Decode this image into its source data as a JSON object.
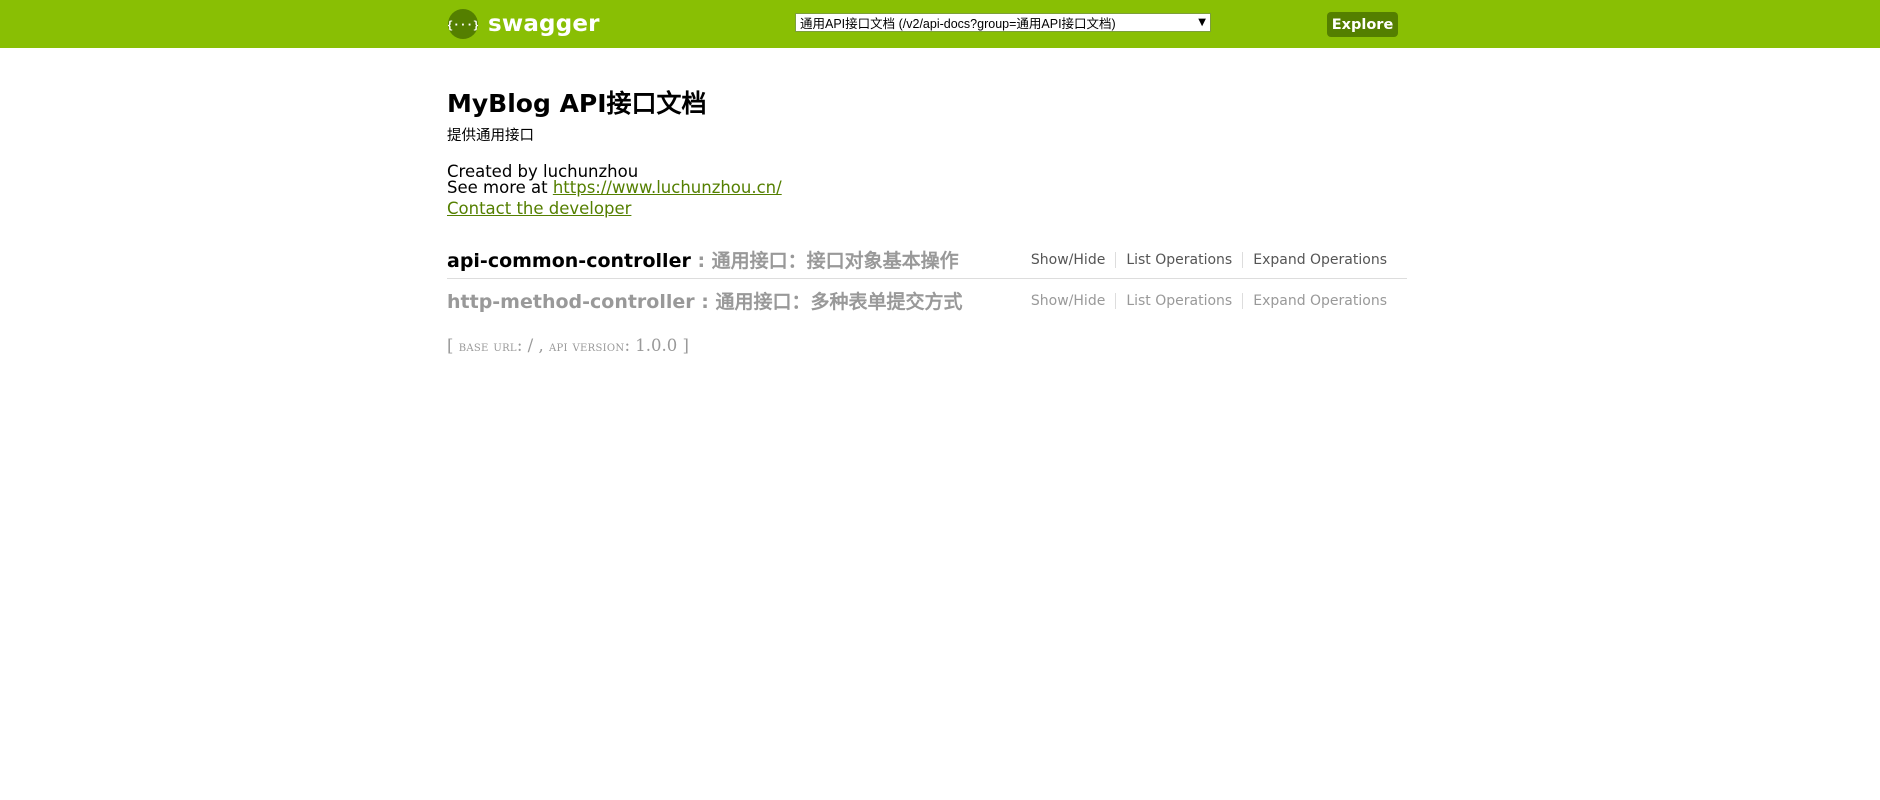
{
  "header": {
    "brand_name": "swagger",
    "spec_select_value": "通用API接口文档 (/v2/api-docs?group=通用API接口文档)",
    "explore_label": "Explore",
    "colors": {
      "bar": "#89bf04",
      "accent": "#547f00"
    }
  },
  "info": {
    "title": "MyBlog API接口文档",
    "description": "提供通用接口",
    "created_by": "Created by luchunzhou",
    "see_more_prefix": "See more at ",
    "see_more_link": "https://www.luchunzhou.cn/",
    "contact_label": "Contact the developer"
  },
  "resources": [
    {
      "name": "api-common-controller",
      "description": " : 通用接口：接口对象基本操作",
      "ops": {
        "show_hide": "Show/Hide",
        "list": "List Operations",
        "expand": "Expand Operations"
      }
    },
    {
      "name": "http-method-controller",
      "description": " : 通用接口：多种表单提交方式",
      "ops": {
        "show_hide": "Show/Hide",
        "list": "List Operations",
        "expand": "Expand Operations"
      }
    }
  ],
  "footer": {
    "open": "[ ",
    "base_url_label": "base url",
    "colon1": ": ",
    "base_url_value": "/",
    "sep": " , ",
    "api_version_label": "api version",
    "colon2": ": ",
    "api_version_value": "1.0.0",
    "close": " ]"
  }
}
